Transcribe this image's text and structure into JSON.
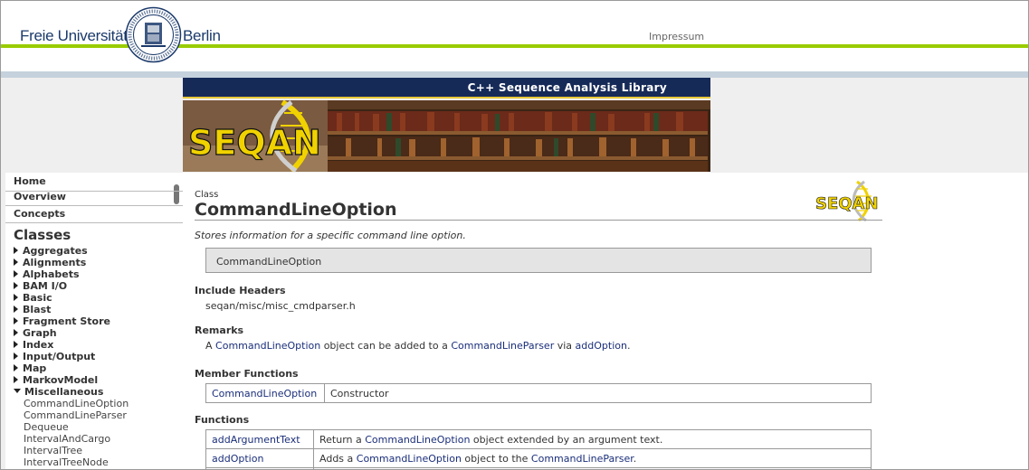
{
  "header": {
    "fu_left": "Freie Universität",
    "fu_right": "Berlin",
    "impressum": "Impressum"
  },
  "banner": {
    "title": "C++ Sequence Analysis Library",
    "logo_text": "SEQAN"
  },
  "sidebar": {
    "top_items": [
      "Home",
      "Overview",
      "Concepts"
    ],
    "heading": "Classes",
    "classes": [
      "Aggregates",
      "Alignments",
      "Alphabets",
      "BAM I/O",
      "Basic",
      "Blast",
      "Fragment Store",
      "Graph",
      "Index",
      "Input/Output",
      "Map",
      "MarkovModel"
    ],
    "expanded": "Miscellaneous",
    "sub_items": [
      "CommandLineOption",
      "CommandLineParser",
      "Dequeue",
      "IntervalAndCargo",
      "IntervalTree",
      "IntervalTreeNode"
    ]
  },
  "content": {
    "class_label": "Class",
    "title": "CommandLineOption",
    "description": "Stores information for a specific command line option.",
    "signature": "CommandLineOption",
    "include_heading": "Include Headers",
    "include_path": "seqan/misc/misc_cmdparser.h",
    "remarks_heading": "Remarks",
    "remarks": {
      "pre": "A ",
      "link1": "CommandLineOption",
      "mid1": " object can be added to a ",
      "link2": "CommandLineParser",
      "mid2": " via ",
      "link3": "addOption",
      "post": "."
    },
    "member_functions_heading": "Member Functions",
    "member_functions": [
      {
        "name": "CommandLineOption",
        "desc": "Constructor"
      }
    ],
    "functions_heading": "Functions",
    "functions": [
      {
        "name": "addArgumentText",
        "pre": "Return a ",
        "link": "CommandLineOption",
        "post": " object extended by an argument text.",
        "link2": "",
        "post2": ""
      },
      {
        "name": "addOption",
        "pre": "Adds a ",
        "link": "CommandLineOption",
        "post": " object to the ",
        "link2": "CommandLineParser",
        "post2": "."
      }
    ]
  },
  "colors": {
    "fu_green": "#99cc00",
    "banner_navy": "#162a58",
    "link": "#1a2e7a",
    "seqan_yellow": "#f0d200"
  }
}
